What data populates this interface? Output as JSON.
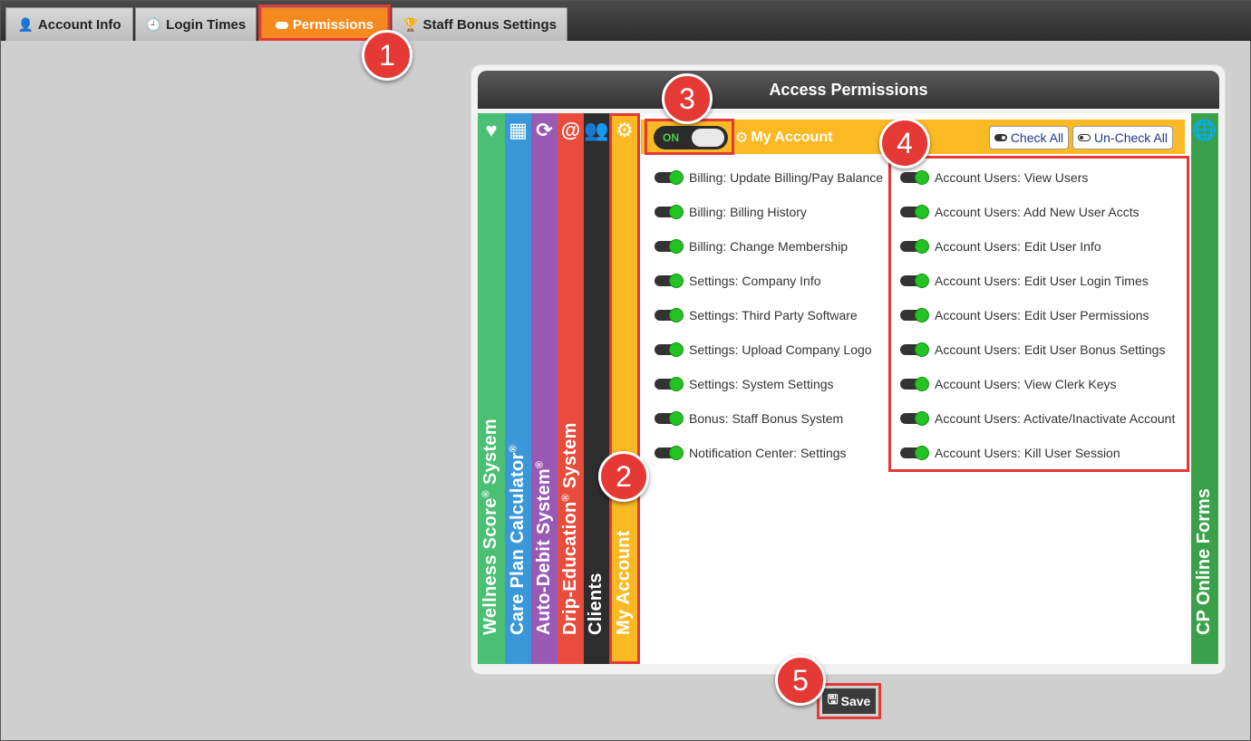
{
  "tabs": [
    {
      "label": "Account Info",
      "icon": "user-icon",
      "glyph": "👤"
    },
    {
      "label": "Login Times",
      "icon": "clock-icon",
      "glyph": "🕘"
    },
    {
      "label": "Permissions",
      "icon": "toggle-icon",
      "glyph": "⊂"
    },
    {
      "label": "Staff Bonus Settings",
      "icon": "trophy-icon",
      "glyph": "🏆"
    }
  ],
  "active_tab": "Permissions",
  "panel_title": "Access Permissions",
  "categories": [
    {
      "label": "Wellness Score",
      "suffix": "System",
      "reg": "®",
      "icon": "heartbeat-icon",
      "glyph": "♥",
      "color": "#4bbf73"
    },
    {
      "label": "Care Plan Calculator",
      "suffix": "",
      "reg": "®",
      "icon": "calculator-icon",
      "glyph": "▦",
      "color": "#3a98d8"
    },
    {
      "label": "Auto-Debit System",
      "suffix": "",
      "reg": "®",
      "icon": "refresh-icon",
      "glyph": "⟳",
      "color": "#9b59b6"
    },
    {
      "label": "Drip-Education",
      "suffix": "System",
      "reg": "®",
      "icon": "at-icon",
      "glyph": "@",
      "color": "#e74c3c"
    },
    {
      "label": "Clients",
      "suffix": "",
      "reg": "",
      "icon": "users-icon",
      "glyph": "👥",
      "color": "#2d2d2d"
    },
    {
      "label": "My Account",
      "suffix": "",
      "reg": "",
      "icon": "gear-icon",
      "glyph": "⚙",
      "color": "#fbb924"
    }
  ],
  "right_category": {
    "label": "CP Online Forms",
    "icon": "globe-icon",
    "glyph": "🌐",
    "color": "#3aa14a"
  },
  "section": {
    "toggle_label": "ON",
    "title": "My Account",
    "title_glyph": "⚙",
    "check_all": "Check All",
    "uncheck_all": "Un-Check All"
  },
  "permissions_left": [
    "Billing: Update Billing/Pay Balance",
    "Billing: Billing History",
    "Billing: Change Membership",
    "Settings: Company Info",
    "Settings: Third Party Software",
    "Settings: Upload Company Logo",
    "Settings: System Settings",
    "Bonus: Staff Bonus System",
    "Notification Center: Settings"
  ],
  "permissions_right": [
    "Account Users: View Users",
    "Account Users: Add New User Accts",
    "Account Users: Edit User Info",
    "Account Users: Edit User Login Times",
    "Account Users: Edit User Permissions",
    "Account Users: Edit User Bonus Settings",
    "Account Users: View Clerk Keys",
    "Account Users: Activate/Inactivate Account",
    "Account Users: Kill User Session"
  ],
  "permissions_enabled": true,
  "save_label": "Save",
  "callouts": [
    "1",
    "2",
    "3",
    "4",
    "5"
  ],
  "colors": {
    "accent": "#f58a1f",
    "highlight": "#e53935",
    "toggle_on": "#22c322",
    "section_bar": "#fbb924"
  }
}
